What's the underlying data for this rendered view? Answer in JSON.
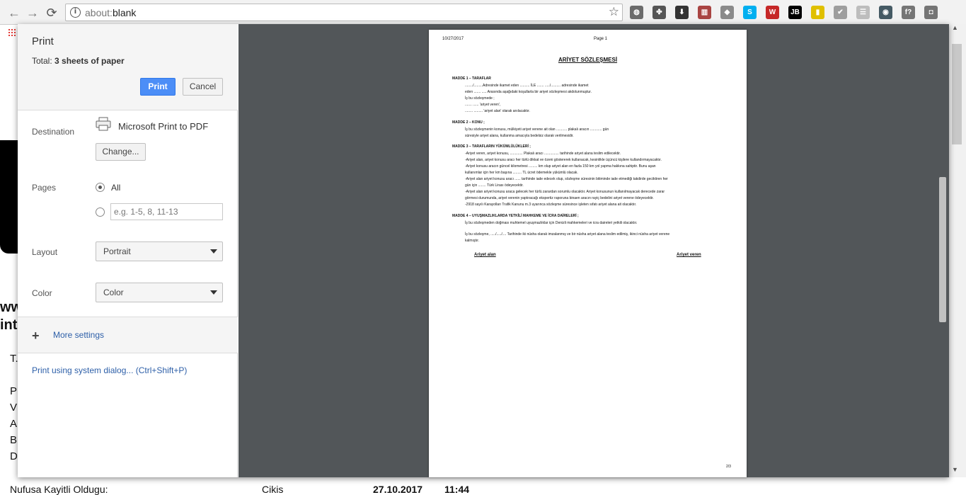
{
  "browser": {
    "url_scheme": "about:",
    "url_path": "blank",
    "extensions": [
      {
        "name": "globe-extension-icon",
        "color": "#6b6b6b",
        "glyph": "◍"
      },
      {
        "name": "puzzle-extension-icon",
        "color": "#555555",
        "glyph": "✤"
      },
      {
        "name": "download-extension-icon",
        "color": "#333333",
        "glyph": "⬇"
      },
      {
        "name": "book-extension-icon",
        "color": "#a94442",
        "glyph": "▥"
      },
      {
        "name": "cube-extension-icon",
        "color": "#8a8a8a",
        "glyph": "◆"
      },
      {
        "name": "skype-extension-icon",
        "color": "#00aff0",
        "glyph": "S"
      },
      {
        "name": "w-extension-icon",
        "color": "#c62828",
        "glyph": "W"
      },
      {
        "name": "jb-extension-icon",
        "color": "#000000",
        "glyph": "JB"
      },
      {
        "name": "flashlight-extension-icon",
        "color": "#e0c000",
        "glyph": "▮"
      },
      {
        "name": "check-extension-icon",
        "color": "#9e9e9e",
        "glyph": "✔"
      },
      {
        "name": "page-extension-icon",
        "color": "#bdbdbd",
        "glyph": "☰"
      },
      {
        "name": "eye-extension-icon",
        "color": "#455a64",
        "glyph": "◉"
      },
      {
        "name": "formula-extension-icon",
        "color": "#757575",
        "glyph": "f?"
      },
      {
        "name": "camera-extension-icon",
        "color": "#757575",
        "glyph": "◘"
      }
    ]
  },
  "background_page": {
    "fragments": [
      "ww",
      "int",
      "T.",
      "P",
      "V",
      "A",
      "B",
      "D"
    ],
    "bottom_row": {
      "label": "Nufusa Kayitli Oldugu:",
      "action": "Cikis",
      "date": "27.10.2017",
      "time": "11:44"
    }
  },
  "print_dialog": {
    "title": "Print",
    "total_prefix": "Total: ",
    "total_value": "3 sheets of paper",
    "print_button": "Print",
    "cancel_button": "Cancel",
    "destination": {
      "label": "Destination",
      "printer": "Microsoft Print to PDF",
      "change_button": "Change..."
    },
    "pages": {
      "label": "Pages",
      "option_all": "All",
      "range_placeholder": "e.g. 1-5, 8, 11-13"
    },
    "layout": {
      "label": "Layout",
      "value": "Portrait"
    },
    "color": {
      "label": "Color",
      "value": "Color"
    },
    "more_settings": "More settings",
    "system_dialog_link": "Print using system dialog... (Ctrl+Shift+P)"
  },
  "preview_page": {
    "header_date": "10/27/2017",
    "header_page": "Page 1",
    "title": "ARİYET SÖZLEŞMESİ",
    "lines": [
      {
        "text": "MADDE 1 – TARAFLAR",
        "head": true
      },
      {
        "text": "......../.........Adresinde ikamet eden .......... İLE ....... ...../.......... adresinde ikamet",
        "indent": true
      },
      {
        "text": "eden ....... ..... Arasında aşağıdaki koşullarla bir ariyet sözleşmesi akdolunmuştur.",
        "indent": true
      },
      {
        "text": "İş bu sözleşmede ;",
        "indent": true
      },
      {
        "text": "....... ...... 'ariyet veren',",
        "indent": true
      },
      {
        "text": "........ ......... 'ariyet alan' olarak anılacaktır.",
        "indent": true
      },
      {
        "text": "MADDE 2 – KONU ;",
        "head": true
      },
      {
        "text": "İş bu sözleşmenin konusu, mülkiyeti ariyet verene ait olan ........... plakalı aracın ............ gün",
        "indent": true
      },
      {
        "text": "süresiyle ariyet alana, kullanma amacıyla bedelsiz olarak verilmesidir.",
        "indent": true
      },
      {
        "text": "MADDE 3 – TARAFLARIN YÜKÜMLÜLÜKLERİ ;",
        "head": true
      },
      {
        "text": "-Ariyet veren, ariyet konusu, ............. Plakalı aracı ............... tarihinde ariyet alana teslim edilecektir.",
        "indent": true
      },
      {
        "text": "-Ariyet alan, ariyet konusu aracı her türlü dikkat ve özeni göstererek kullanacak, kesinlikle üçüncü kişilere kullandırmayacaktır.",
        "indent": true
      },
      {
        "text": "-Ariyet konusu aracın güncel kilometresi ......... km olup ariyet alan en fazla 150 km yol yapma hakkına sahiptir. Bunu aşan",
        "indent": true
      },
      {
        "text": "kullanımlar için her km başına ......... TL ücret ödemekle yükümlü olacak.",
        "indent": true
      },
      {
        "text": "-Ariyet alan ariyet konusu aracı ...... tarihinde iade edecek olup, sözleşme süresinin bitiminde iade etmediği takdirde geciktiren her",
        "indent": true
      },
      {
        "text": "gün için ........ Türk Lirası ödeyecektir.",
        "indent": true
      },
      {
        "text": "-Ariyet alan ariyet konusu araca gelecek her türlü zarardan sorumlu olacaktır. Ariyet konusunun kullanılmayacak derecede zarar",
        "indent": true
      },
      {
        "text": "görmesi durumunda, ariyet verenin yaptıracağı ekspertiz raporuna binaen aracın rayiç bedelini ariyet verene ödeyecektir.",
        "indent": true
      },
      {
        "text": "-2918 sayılı Karayolları Trafik Kanunu m.3 uyarınca sözleşme süresince işleten sıfatı ariyet alana ait olacaktır.",
        "indent": true
      },
      {
        "text": "MADDE 4 – UYUŞMAZLIKLARDA YETKİLİ MAHKEME VE İCRA DAİRELERİ ;",
        "head": true
      },
      {
        "text": "İş bu sözleşmeden doğması muhtemel uyuşmazlıklar için Denizli mahkemeleri ve icra daireleri yetkili olacaktır.",
        "indent": true
      },
      {
        "text": "İş bu sözleşme, ...../...../.... Tarihinde iki nüsha olarak imzalanmış ve bir nüsha ariyet alana teslim edilmiş, ikinci nüsha ariyet verene",
        "indent": true
      },
      {
        "text": "kalmıştır.",
        "indent": true
      }
    ],
    "sign_left": "Ariyet alan",
    "sign_right": "Ariyet veren",
    "footer": "2/3"
  }
}
